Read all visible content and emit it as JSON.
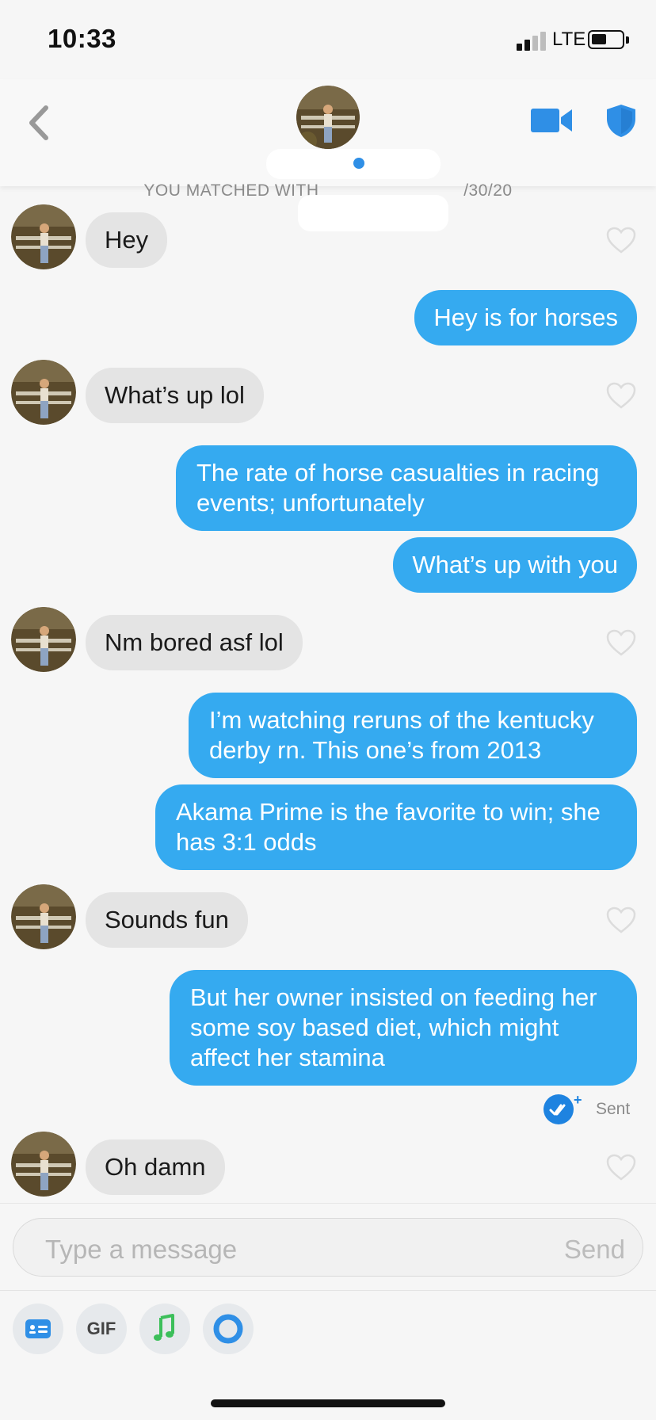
{
  "status_bar": {
    "time": "10:33",
    "network": "LTE"
  },
  "header": {
    "back_icon": "chevron-left-icon",
    "video_icon": "video-camera-icon",
    "shield_icon": "shield-icon",
    "accent_color": "#2f8fe6"
  },
  "matched_text": {
    "prefix": "YOU MATCHED WITH",
    "date_suffix": "/30/20"
  },
  "messages": [
    {
      "direction": "in",
      "text": "Hey"
    },
    {
      "direction": "out",
      "text": "Hey is for horses"
    },
    {
      "direction": "in",
      "text": "What’s up lol"
    },
    {
      "direction": "out",
      "lines": [
        "The rate of horse casualties in racing",
        "events; unfortunately"
      ]
    },
    {
      "direction": "out",
      "text": "What’s up with you"
    },
    {
      "direction": "in",
      "text": "Nm bored asf lol"
    },
    {
      "direction": "out",
      "lines": [
        "I’m watching reruns of the kentucky",
        "derby rn. This one’s from 2013"
      ]
    },
    {
      "direction": "out",
      "lines": [
        "Akama Prime is the favorite to win; she",
        "has 3:1 odds"
      ]
    },
    {
      "direction": "in",
      "text": "Sounds fun"
    },
    {
      "direction": "out",
      "lines": [
        "But her owner insisted on feeding her",
        "some soy based diet, which might",
        "affect her stamina"
      ]
    },
    {
      "direction": "in",
      "text": "Oh damn"
    }
  ],
  "read_receipt": {
    "label": "Sent",
    "icon": "double-check-icon"
  },
  "composer": {
    "placeholder": "Type a message",
    "send_label": "Send"
  },
  "toolbar": {
    "items": [
      {
        "icon": "card-icon"
      },
      {
        "label": "GIF"
      },
      {
        "icon": "music-note-icon"
      },
      {
        "icon": "ring-icon"
      }
    ]
  },
  "colors": {
    "incoming_bubble": "#e4e4e4",
    "outgoing_bubble": "#35aaf0",
    "background": "#f6f6f6"
  }
}
